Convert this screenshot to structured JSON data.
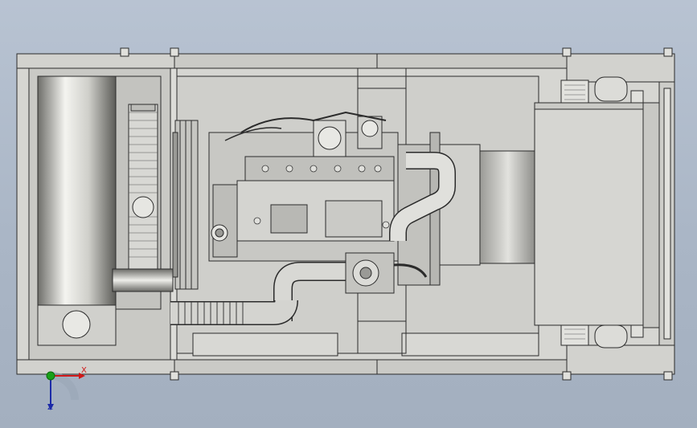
{
  "view": {
    "background_color": "#aab6c6",
    "line_color": "#2b2b2b",
    "body_color": "#cfcfcb",
    "frame_color": "#d6d6d2"
  },
  "triad": {
    "x_label": "X",
    "z_label": "Z",
    "x_color": "#d01818",
    "y_color": "#18a018",
    "z_color": "#1c2aa8"
  }
}
